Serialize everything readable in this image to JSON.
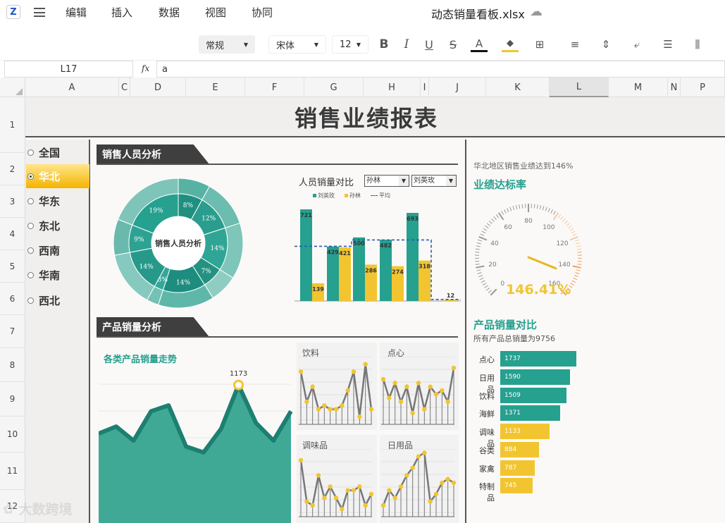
{
  "app": {
    "doc_title": "动态销量看板.xlsx"
  },
  "menu": [
    "编辑",
    "插入",
    "数据",
    "视图",
    "协同"
  ],
  "toolbar": {
    "number_format": "常规",
    "font": "宋体",
    "font_size": "12"
  },
  "formula_bar": {
    "cell_ref": "L17",
    "fx": "fx",
    "value": "a"
  },
  "columns": [
    "A",
    "C",
    "D",
    "E",
    "F",
    "G",
    "H",
    "I",
    "J",
    "K",
    "L",
    "M",
    "N",
    "P"
  ],
  "rows": [
    "1",
    "2",
    "3",
    "4",
    "5",
    "6",
    "7",
    "8",
    "9",
    "10",
    "11",
    "12"
  ],
  "title": "销售业绩报表",
  "regions": [
    "全国",
    "华北",
    "华东",
    "东北",
    "西南",
    "华南",
    "西北"
  ],
  "selected_region": "华北",
  "section1": {
    "title": "销售人员分析",
    "donut_center": "销售人员分析",
    "donut_labels": [
      "8%",
      "12%",
      "14%",
      "7%",
      "14%",
      "3%",
      "14%",
      "9%",
      "19%"
    ],
    "compare_title": "人员销量对比",
    "select_a": "孙林",
    "select_b": "刘英玫",
    "legend": [
      "刘英玫",
      "孙林",
      "平均"
    ]
  },
  "section2": {
    "title": "产品销量分析",
    "trend_title": "各类产品销量走势",
    "peak_label": "1173",
    "small_titles": [
      "饮料",
      "点心",
      "调味品",
      "日用品"
    ]
  },
  "gauge": {
    "note": "华北地区销售业绩达到146%",
    "title": "业绩达标率",
    "value_text": "146.41%",
    "ticks": [
      "0",
      "20",
      "40",
      "60",
      "80",
      "100",
      "120",
      "140",
      "160"
    ]
  },
  "product_compare": {
    "title": "产品销量对比",
    "subtitle": "所有产品总销量为9756"
  },
  "watermark": "大数跨境",
  "chart_data": [
    {
      "type": "bar",
      "title": "人员销量对比",
      "series": [
        {
          "name": "刘英玫",
          "values": [
            721,
            429,
            500,
            482,
            693,
            0
          ]
        },
        {
          "name": "孙林",
          "values": [
            139,
            421,
            286,
            274,
            318,
            12
          ]
        },
        {
          "name": "平均",
          "values": [
            430,
            430,
            480,
            480,
            480,
            12
          ]
        }
      ],
      "colors": [
        "#26a08f",
        "#f2c530",
        "#2b5caa"
      ]
    },
    {
      "type": "bar",
      "title": "产品销量对比",
      "orientation": "horizontal",
      "categories": [
        "点心",
        "日用品",
        "饮料",
        "海鲜",
        "调味品",
        "谷类",
        "家禽",
        "特制品"
      ],
      "values": [
        1737,
        1590,
        1509,
        1371,
        1133,
        884,
        787,
        745
      ],
      "colors": [
        "#26a08f",
        "#26a08f",
        "#26a08f",
        "#26a08f",
        "#f2c530",
        "#f2c530",
        "#f2c530",
        "#f2c530"
      ]
    },
    {
      "type": "area",
      "title": "各类产品销量走势",
      "values": [
        760,
        820,
        700,
        950,
        1000,
        650,
        600,
        800,
        1173,
        850,
        700,
        950
      ],
      "ylim": [
        0,
        1300
      ]
    },
    {
      "type": "line",
      "title": "饮料",
      "values": [
        70,
        30,
        50,
        20,
        25,
        20,
        20,
        25,
        45,
        70,
        10,
        80,
        20
      ]
    },
    {
      "type": "line",
      "title": "点心",
      "values": [
        60,
        35,
        55,
        30,
        50,
        15,
        55,
        20,
        50,
        40,
        45,
        30,
        75
      ]
    },
    {
      "type": "line",
      "title": "调味品",
      "values": [
        75,
        20,
        15,
        55,
        25,
        40,
        25,
        10,
        35,
        35,
        40,
        15,
        30
      ]
    },
    {
      "type": "line",
      "title": "日用品",
      "values": [
        15,
        35,
        25,
        40,
        55,
        65,
        80,
        85,
        20,
        30,
        45,
        50,
        45
      ]
    }
  ]
}
